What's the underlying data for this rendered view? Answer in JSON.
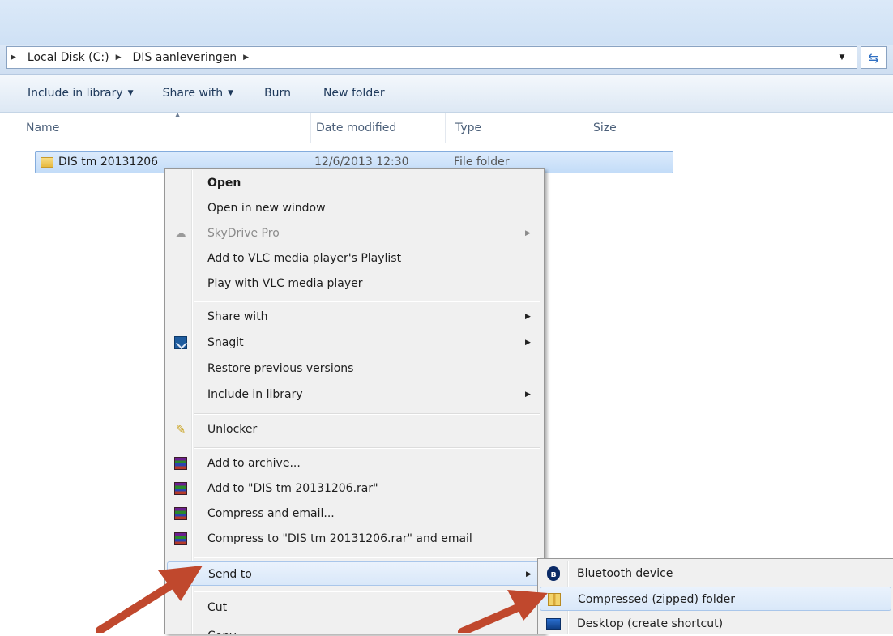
{
  "address": {
    "crumbs": [
      "Local Disk (C:)",
      "DIS aanleveringen"
    ]
  },
  "toolbar": {
    "include_library": "Include in library",
    "share_with": "Share with",
    "burn": "Burn",
    "new_folder": "New folder"
  },
  "columns": {
    "name": "Name",
    "date": "Date modified",
    "type": "Type",
    "size": "Size"
  },
  "file": {
    "name": "DIS tm 20131206",
    "date": "12/6/2013 12:30",
    "type": "File folder"
  },
  "context_menu": {
    "open": "Open",
    "open_new_window": "Open in new window",
    "skydrive": "SkyDrive Pro",
    "add_vlc_playlist": "Add to VLC media player's Playlist",
    "play_vlc": "Play with VLC media player",
    "share_with": "Share with",
    "snagit": "Snagit",
    "restore_versions": "Restore previous versions",
    "include_library": "Include in library",
    "unlocker": "Unlocker",
    "add_archive": "Add to archive...",
    "add_to_rar": "Add to \"DIS tm 20131206.rar\"",
    "compress_email": "Compress and email...",
    "compress_to_rar_email": "Compress to \"DIS tm 20131206.rar\" and email",
    "send_to": "Send to",
    "cut": "Cut",
    "copy": "Copy"
  },
  "send_to_menu": {
    "bluetooth": "Bluetooth device",
    "compressed": "Compressed (zipped) folder",
    "desktop": "Desktop (create shortcut)"
  },
  "colors": {
    "arrow": "#c0482d",
    "selection": "#cce2fa"
  }
}
